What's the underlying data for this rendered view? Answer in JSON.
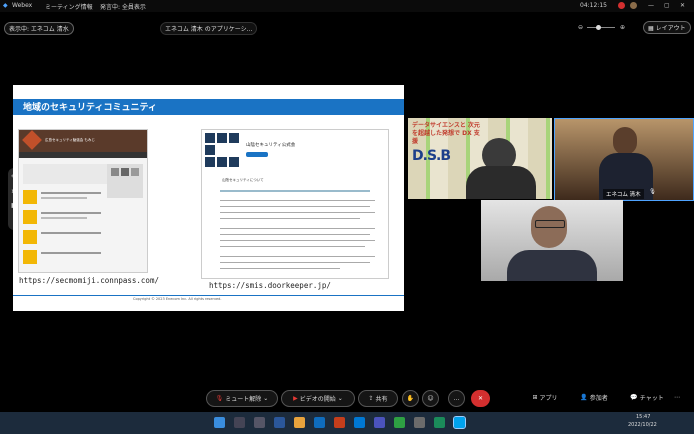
{
  "titlebar": {
    "app_name": "Webex",
    "info_label": "ミーティング情報",
    "speaker_label": "発言中: 全員表示",
    "time": "04:12:15"
  },
  "stage": {
    "viewing_label": "表示中: エネコム 清水",
    "sharing_label": "エネコム 清木 のアプリケーシ...",
    "layout_label": "レイアウト"
  },
  "slide": {
    "title": "地域のセキュリティコミュニティ",
    "url_left": "https://secmomiji.connpass.com/",
    "url_right": "https://smis.doorkeeper.jp/",
    "site_left_title": "広島セキュリティ勉強会 もみじ",
    "site_right_title": "山陰セキュリティ公式会",
    "site_right_subtitle": "山陰セキュリティについて",
    "footer_text": "Copyright © 2023 Enecom Inc. All rights reserved."
  },
  "videos": {
    "banner_text": "データサイエンスと 次元を超越した発想で DX 支援",
    "banner_brand": "D.S.B",
    "host_name": "エネコム 清木"
  },
  "controls": {
    "mute_label": "ミュート解除",
    "video_label": "ビデオの開始",
    "share_label": "共有",
    "more_label": "...",
    "apps_label": "アプリ",
    "participants_label": "参加者",
    "chat_label": "チャット"
  },
  "taskbar": {
    "time": "15:47",
    "date": "2022/10/22"
  },
  "colors": {
    "accent_blue": "#1a73c4",
    "end_red": "#d32f2f"
  }
}
